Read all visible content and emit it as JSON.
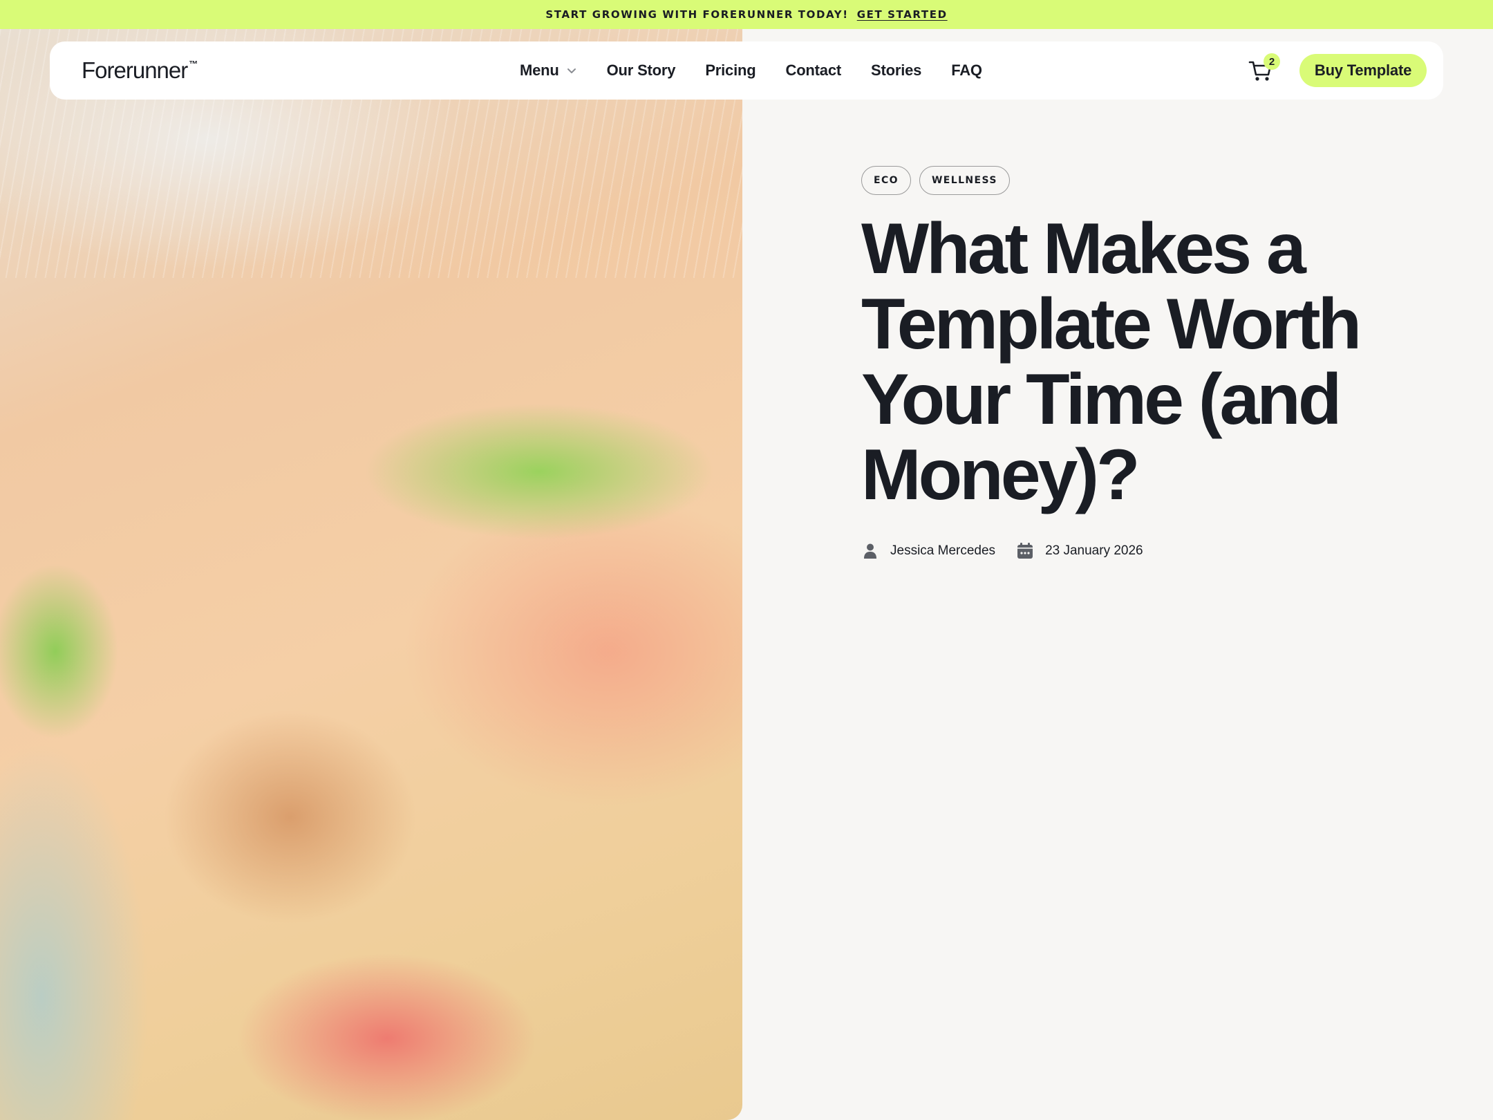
{
  "announcement": {
    "text": "START GROWING WITH FORERUNNER TODAY!",
    "link": "GET STARTED"
  },
  "header": {
    "logo": "Forerunner",
    "logo_mark": "™",
    "nav": [
      "Menu",
      "Our Story",
      "Pricing",
      "Contact",
      "Stories",
      "FAQ"
    ],
    "cart_count": "2",
    "cta": "Buy Template"
  },
  "article": {
    "tags": [
      "ECO",
      "WELLNESS"
    ],
    "title": "What Makes a Template Worth Your Time (and Money)?",
    "author": "Jessica Mercedes",
    "date": "23 January 2026"
  },
  "icons": {
    "menu_dropdown": "chevron-down-icon",
    "cart": "cart-icon",
    "author": "person-icon",
    "date": "calendar-icon"
  },
  "colors": {
    "accent": "#d9fb77",
    "text": "#1a1d24",
    "background": "#f7f6f4"
  }
}
